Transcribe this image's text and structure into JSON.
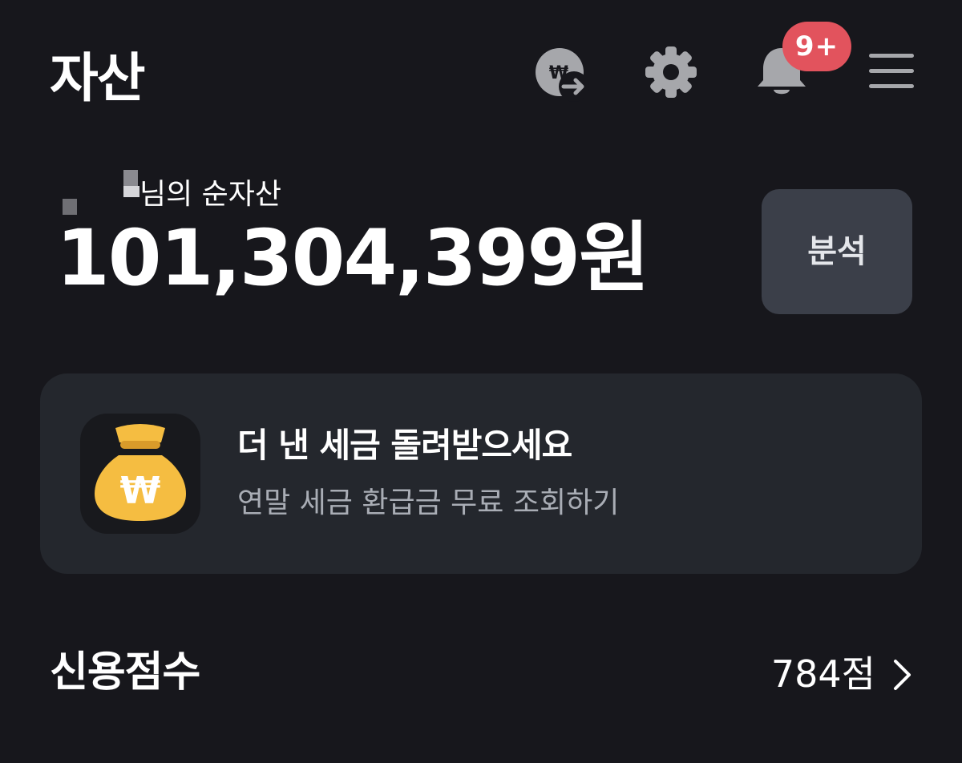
{
  "header": {
    "title": "자산",
    "notification_badge": "9+",
    "icons": [
      "won-transfer-icon",
      "gear-icon",
      "bell-icon",
      "menu-icon"
    ]
  },
  "summary": {
    "owner_label": "님의 순자산",
    "net_worth": "101,304,399원",
    "analyze_button": "분석"
  },
  "promo": {
    "title": "더 낸 세금 돌려받으세요",
    "subtitle": "연말 세금 환급금 무료 조회하기",
    "icon": "money-bag-icon"
  },
  "credit": {
    "title": "신용점수",
    "value": "784점"
  },
  "colors": {
    "background": "#17171c",
    "card": "#24272d",
    "button": "#3b3f49",
    "badge": "#e2535d",
    "icon_gray": "#a6a7ab",
    "money_bag": "#f5bd41"
  }
}
